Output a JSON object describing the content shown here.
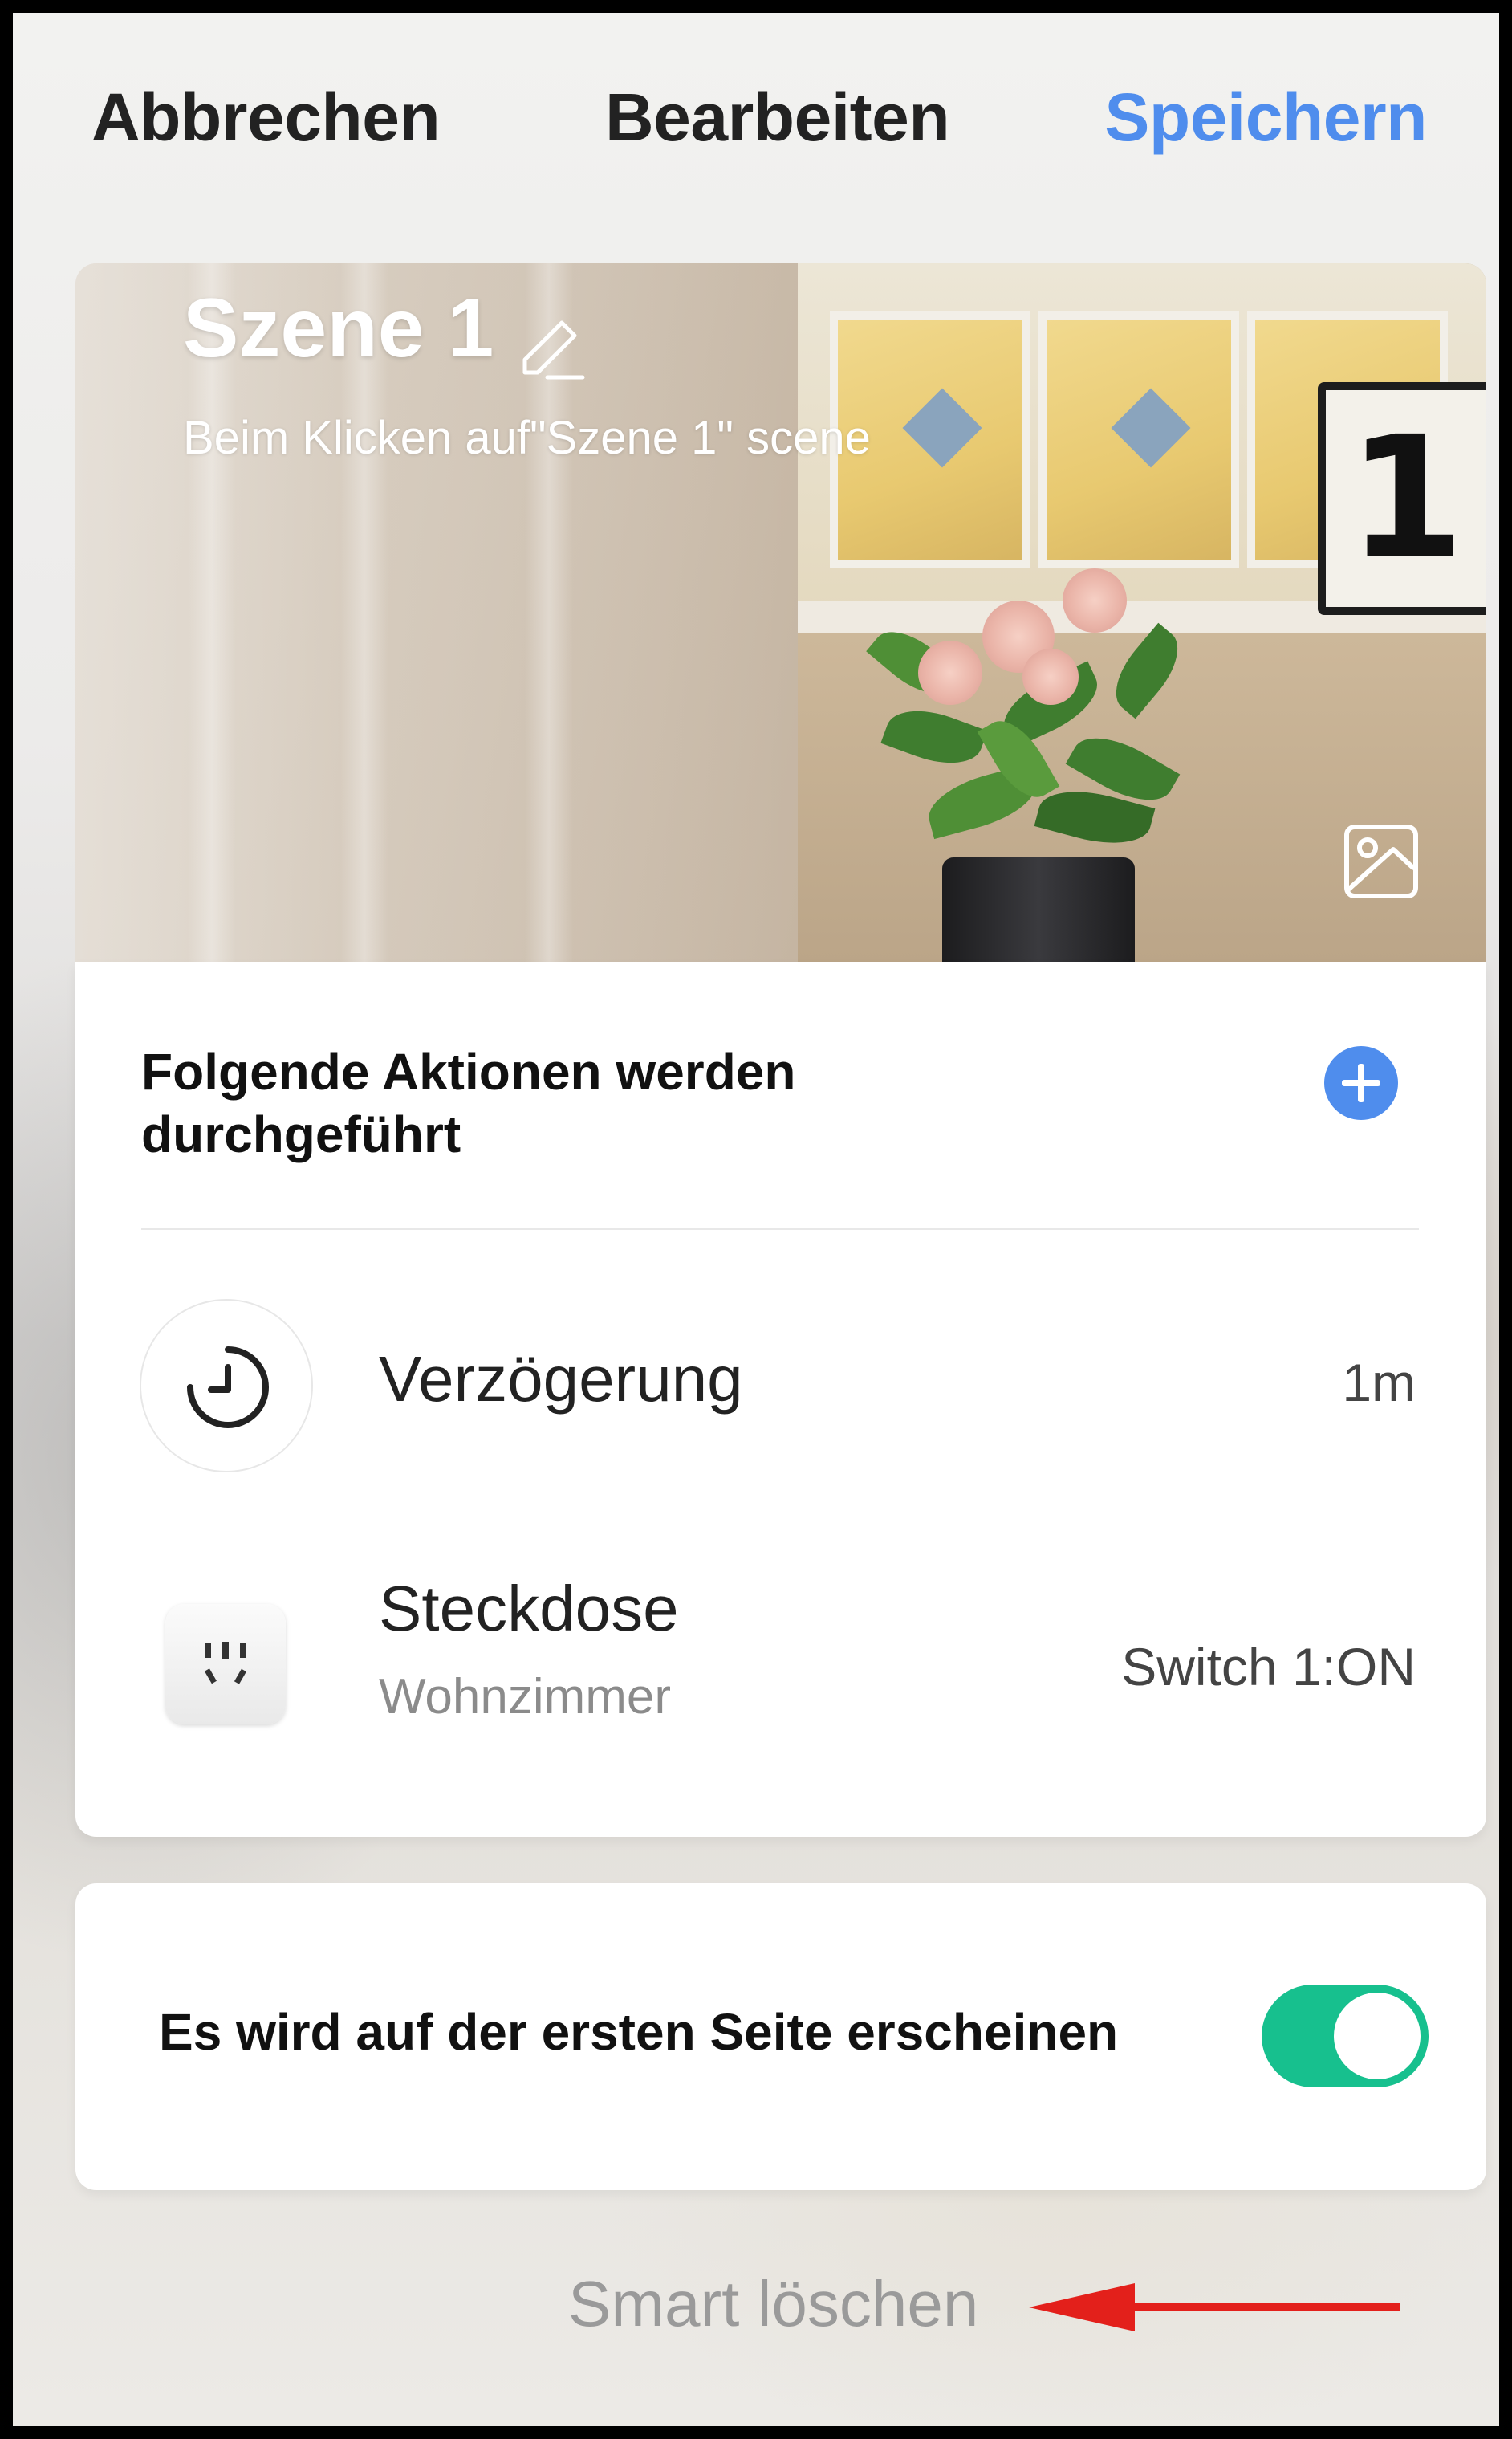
{
  "header": {
    "cancel_label": "Abbrechen",
    "title": "Bearbeiten",
    "save_label": "Speichern"
  },
  "scene": {
    "name": "Szene 1",
    "description": "Beim Klicken auf\"Szene 1\" scene",
    "number_sign": "1",
    "edit_icon": "pencil-icon",
    "image_icon": "image-icon"
  },
  "actions": {
    "title": "Folgende Aktionen werden durchgeführt",
    "add_icon": "plus-circle-icon",
    "items": [
      {
        "icon": "clock-icon",
        "label": "Verzögerung",
        "value": "1m"
      },
      {
        "icon": "power-socket-icon",
        "label": "Steckdose",
        "room": "Wohnzimmer",
        "value": "Switch 1:ON"
      }
    ]
  },
  "home_display": {
    "label": "Es wird auf der ersten Seite erscheinen",
    "enabled": true
  },
  "delete_label": "Smart löschen",
  "colors": {
    "accent": "#4f8ded",
    "toggle_on": "#17c08e",
    "annotation_arrow": "#e3201b"
  }
}
